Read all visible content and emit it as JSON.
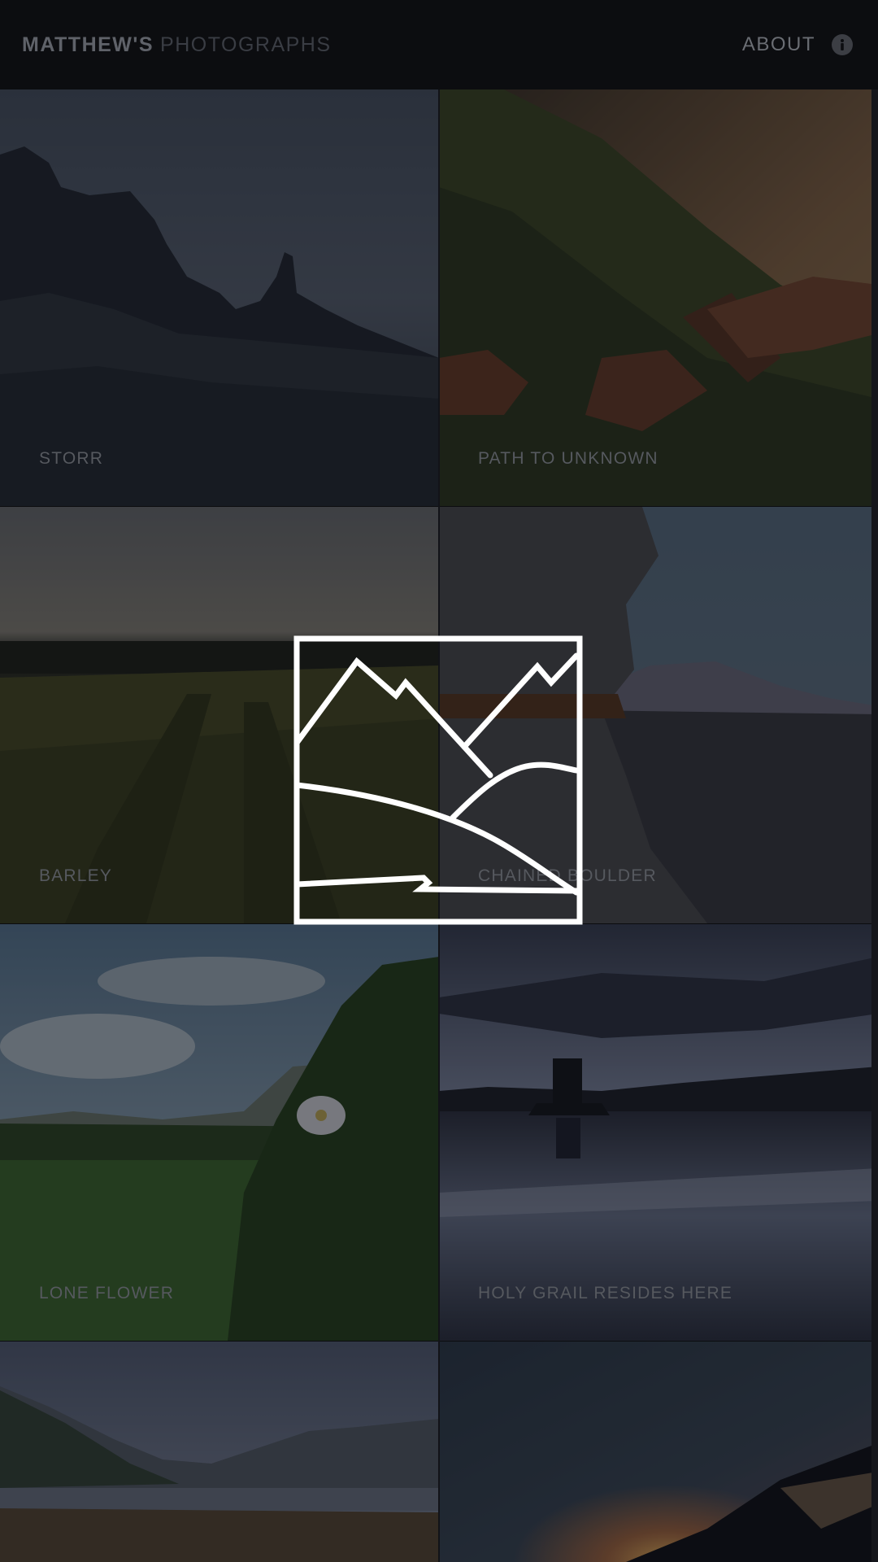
{
  "header": {
    "brand_primary": "MATTHEW'S",
    "brand_secondary": "PHOTOGRAPHS",
    "about_label": "ABOUT",
    "info_icon": "info-circle-icon"
  },
  "gallery": {
    "tiles": [
      {
        "caption": "STORR"
      },
      {
        "caption": "PATH TO UNKNOWN"
      },
      {
        "caption": "BARLEY"
      },
      {
        "caption": "CHAINED BOULDER"
      },
      {
        "caption": "LONE FLOWER"
      },
      {
        "caption": "HOLY GRAIL RESIDES HERE"
      },
      {
        "caption": ""
      },
      {
        "caption": ""
      }
    ]
  },
  "overlay": {
    "icon": "mountain-landscape-logo-icon"
  },
  "colors": {
    "background": "#0b0c0f",
    "header": "#0c0d10",
    "caption_text": "#56595f",
    "logo_stroke": "#ffffff"
  }
}
